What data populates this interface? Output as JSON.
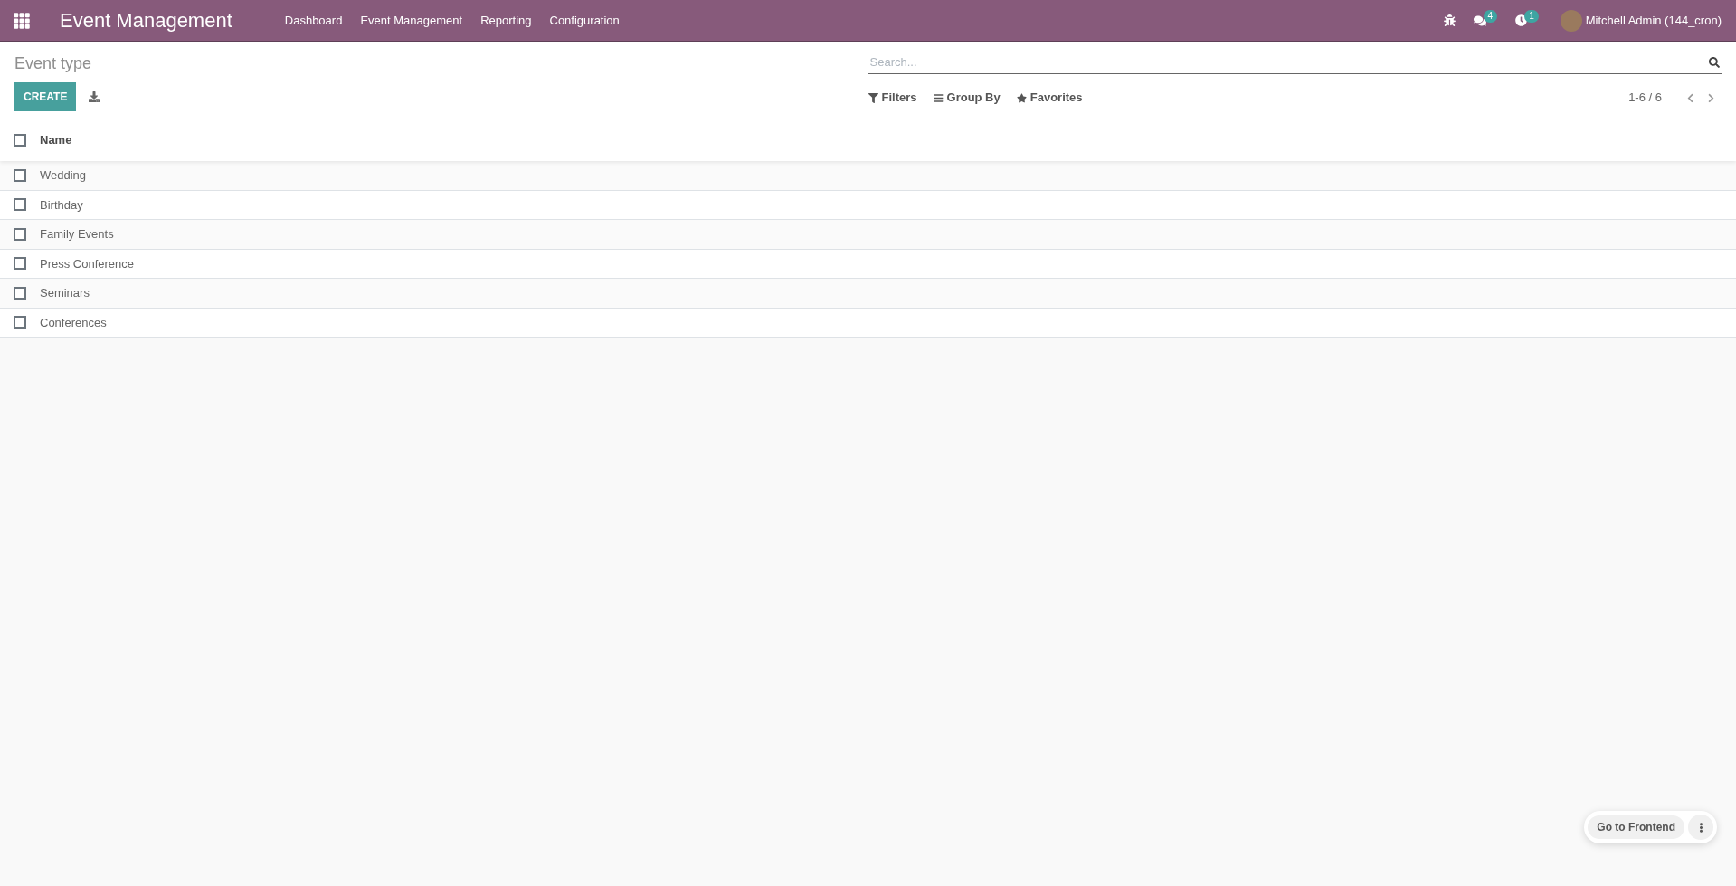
{
  "navbar": {
    "app_title": "Event Management",
    "menu": [
      "Dashboard",
      "Event Management",
      "Reporting",
      "Configuration"
    ],
    "messages_count": "4",
    "activities_count": "1",
    "user": "Mitchell Admin (144_cron)"
  },
  "control_panel": {
    "breadcrumb": "Event type",
    "create_label": "CREATE",
    "search": {
      "placeholder": "Search..."
    },
    "filters": [
      "Filters",
      "Group By",
      "Favorites"
    ],
    "pager": "1-6 / 6"
  },
  "table": {
    "columns": [
      "Name"
    ],
    "header_checked": false,
    "rows": [
      {
        "name": "Wedding",
        "checked": false
      },
      {
        "name": "Birthday",
        "checked": false
      },
      {
        "name": "Family Events",
        "checked": false
      },
      {
        "name": "Press Conference",
        "checked": false
      },
      {
        "name": "Seminars",
        "checked": false
      },
      {
        "name": "Conferences",
        "checked": false
      }
    ]
  },
  "frontend_button": "Go to Frontend"
}
